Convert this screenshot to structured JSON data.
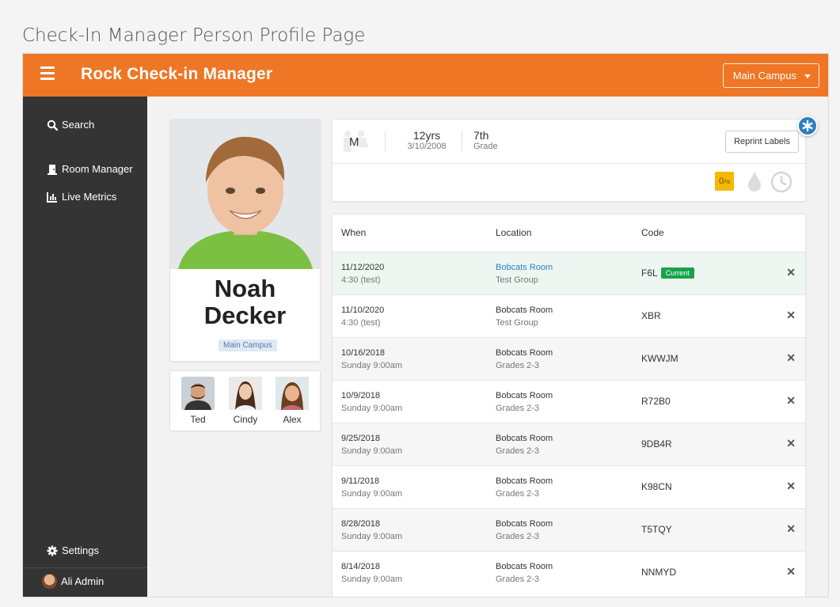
{
  "caption": "Check-In Manager Person Profile Page",
  "app": {
    "title": "Rock Check-in Manager",
    "campus_selector": "Main Campus"
  },
  "sidebar": {
    "items": [
      {
        "label": "Search",
        "icon": "search-icon"
      },
      {
        "label": "Room Manager",
        "icon": "door-icon"
      },
      {
        "label": "Live Metrics",
        "icon": "chart-icon"
      }
    ],
    "settings": {
      "label": "Settings",
      "icon": "gear-icon"
    },
    "user": {
      "label": "Ali Admin"
    }
  },
  "person": {
    "first_name": "Noah",
    "last_name": "Decker",
    "campus": "Main Campus",
    "gender": "M",
    "age": "12yrs",
    "birthdate": "3/10/2008",
    "grade": "7th",
    "grade_label": "Grade",
    "reprint_label": "Reprint Labels",
    "score_badge": "0",
    "score_suffix": "/%"
  },
  "family": [
    {
      "name": "Ted"
    },
    {
      "name": "Cindy"
    },
    {
      "name": "Alex"
    }
  ],
  "table": {
    "headers": {
      "when": "When",
      "location": "Location",
      "code": "Code"
    },
    "current_badge": "Current",
    "rows": [
      {
        "date": "11/12/2020",
        "time": "4:30 (test)",
        "location": "Bobcats Room",
        "group": "Test Group",
        "code": "F6L",
        "current": true
      },
      {
        "date": "11/10/2020",
        "time": "4:30 (test)",
        "location": "Bobcats Room",
        "group": "Test Group",
        "code": "XBR",
        "current": false
      },
      {
        "date": "10/16/2018",
        "time": "Sunday 9:00am",
        "location": "Bobcats Room",
        "group": "Grades 2-3",
        "code": "KWWJM",
        "current": false
      },
      {
        "date": "10/9/2018",
        "time": "Sunday 9:00am",
        "location": "Bobcats Room",
        "group": "Grades 2-3",
        "code": "R72B0",
        "current": false
      },
      {
        "date": "9/25/2018",
        "time": "Sunday 9:00am",
        "location": "Bobcats Room",
        "group": "Grades 2-3",
        "code": "9DB4R",
        "current": false
      },
      {
        "date": "9/11/2018",
        "time": "Sunday 9:00am",
        "location": "Bobcats Room",
        "group": "Grades 2-3",
        "code": "K98CN",
        "current": false
      },
      {
        "date": "8/28/2018",
        "time": "Sunday 9:00am",
        "location": "Bobcats Room",
        "group": "Grades 2-3",
        "code": "T5TQY",
        "current": false
      },
      {
        "date": "8/14/2018",
        "time": "Sunday 9:00am",
        "location": "Bobcats Room",
        "group": "Grades 2-3",
        "code": "NNMYD",
        "current": false
      }
    ]
  },
  "colors": {
    "brand": "#ee7625",
    "sidebar": "#343434",
    "link": "#2f7ec1",
    "current": "#16a34a",
    "score": "#f5b800"
  }
}
